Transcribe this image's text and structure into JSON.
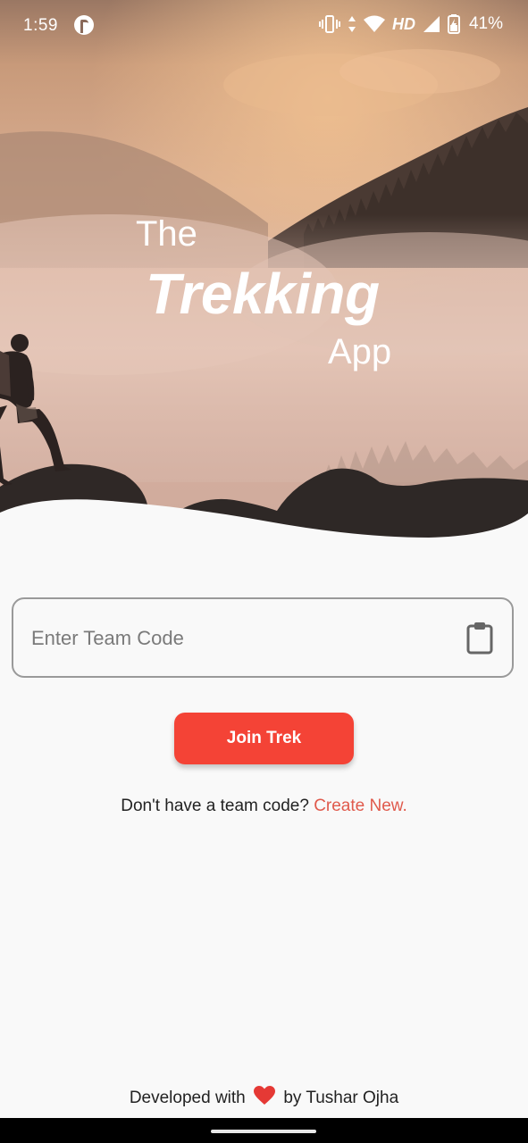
{
  "status_bar": {
    "time": "1:59",
    "network": "HD",
    "battery": "41%",
    "icons": [
      "app-notification-icon",
      "vibrate-icon",
      "data-arrows-icon",
      "wifi-icon",
      "cell-signal-icon",
      "battery-icon"
    ]
  },
  "hero": {
    "title_the": "The",
    "title_trekking": "Trekking",
    "title_app": "App"
  },
  "form": {
    "team_code_placeholder": "Enter Team Code",
    "team_code_value": "",
    "paste_icon": "clipboard-icon",
    "join_label": "Join Trek",
    "prompt_text": "Don't have a team code?",
    "create_link": "Create New."
  },
  "footer": {
    "prefix": "Developed with",
    "heart_icon": "heart-icon",
    "suffix": "by Tushar Ojha"
  },
  "colors": {
    "accent": "#f44336",
    "link": "#e05a4c",
    "background": "#f9f9f9"
  }
}
